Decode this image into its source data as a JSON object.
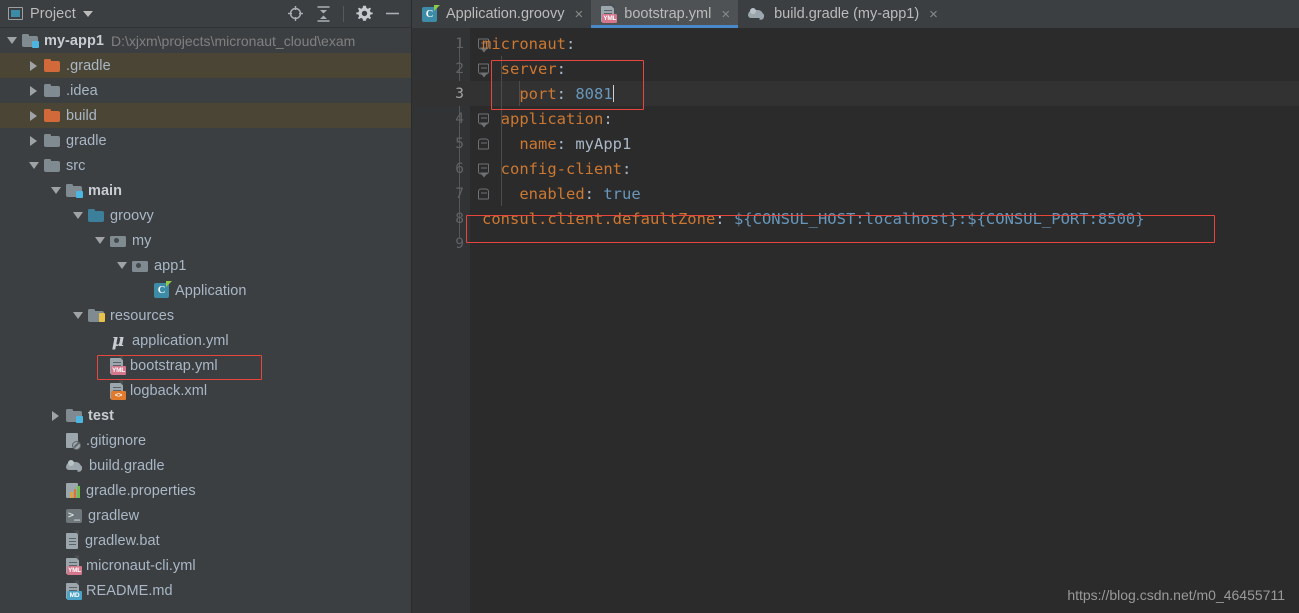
{
  "panel": {
    "title": "Project",
    "window_icon": "window-icon",
    "dropdown_icon": "chevron-down-icon",
    "tools": [
      {
        "name": "locate-icon",
        "label": ""
      },
      {
        "name": "collapse-all-icon",
        "label": ""
      },
      {
        "name": "gear-icon",
        "label": ""
      },
      {
        "name": "minimize-icon",
        "label": ""
      }
    ]
  },
  "tree": {
    "root": {
      "label": "my-app1",
      "path": "D:\\xjxm\\projects\\micronaut_cloud\\exam"
    },
    "items": [
      {
        "label": ".gradle",
        "indent": 1,
        "twisty": "right",
        "icon": "folder-orange",
        "excluded": true
      },
      {
        "label": ".idea",
        "indent": 1,
        "twisty": "right",
        "icon": "folder-grey",
        "excluded": false
      },
      {
        "label": "build",
        "indent": 1,
        "twisty": "right",
        "icon": "folder-orange",
        "excluded": true
      },
      {
        "label": "gradle",
        "indent": 1,
        "twisty": "right",
        "icon": "folder-grey",
        "excluded": false
      },
      {
        "label": "src",
        "indent": 1,
        "twisty": "down",
        "icon": "folder-grey",
        "excluded": false
      },
      {
        "label": "main",
        "indent": 2,
        "twisty": "down",
        "icon": "folder-module",
        "excluded": false,
        "bold": true
      },
      {
        "label": "groovy",
        "indent": 3,
        "twisty": "down",
        "icon": "folder-source",
        "excluded": false
      },
      {
        "label": "my",
        "indent": 4,
        "twisty": "down",
        "icon": "package",
        "excluded": false
      },
      {
        "label": "app1",
        "indent": 5,
        "twisty": "down",
        "icon": "package",
        "excluded": false
      },
      {
        "label": "Application",
        "indent": 6,
        "twisty": "none",
        "icon": "groovy-class",
        "excluded": false
      },
      {
        "label": "resources",
        "indent": 3,
        "twisty": "down",
        "icon": "folder-resources",
        "excluded": false
      },
      {
        "label": "application.yml",
        "indent": 4,
        "twisty": "none",
        "icon": "micronaut-file",
        "excluded": false
      },
      {
        "label": "bootstrap.yml",
        "indent": 4,
        "twisty": "none",
        "icon": "yml-file",
        "excluded": false,
        "highlight": true
      },
      {
        "label": "logback.xml",
        "indent": 4,
        "twisty": "none",
        "icon": "xml-file",
        "excluded": false
      },
      {
        "label": "test",
        "indent": 2,
        "twisty": "right",
        "icon": "folder-module",
        "excluded": false,
        "bold": true
      },
      {
        "label": ".gitignore",
        "indent": 2,
        "twisty": "none",
        "icon": "gitignore-file",
        "excluded": false
      },
      {
        "label": "build.gradle",
        "indent": 2,
        "twisty": "none",
        "icon": "gradle-file",
        "excluded": false
      },
      {
        "label": "gradle.properties",
        "indent": 2,
        "twisty": "none",
        "icon": "properties-file",
        "excluded": false
      },
      {
        "label": "gradlew",
        "indent": 2,
        "twisty": "none",
        "icon": "shell-file",
        "excluded": false
      },
      {
        "label": "gradlew.bat",
        "indent": 2,
        "twisty": "none",
        "icon": "bat-file",
        "excluded": false
      },
      {
        "label": "micronaut-cli.yml",
        "indent": 2,
        "twisty": "none",
        "icon": "yml-file",
        "excluded": false
      },
      {
        "label": "README.md",
        "indent": 2,
        "twisty": "none",
        "icon": "md-file",
        "excluded": false
      }
    ]
  },
  "tabs": [
    {
      "label": "Application.groovy",
      "icon": "groovy-class-icon",
      "active": false,
      "close": "×"
    },
    {
      "label": "bootstrap.yml",
      "icon": "yml-file-icon",
      "active": true,
      "close": "×"
    },
    {
      "label": "build.gradle (my-app1)",
      "icon": "gradle-file-icon",
      "active": false,
      "close": "×"
    }
  ],
  "editor": {
    "line_numbers": [
      "1",
      "2",
      "3",
      "4",
      "5",
      "6",
      "7",
      "8",
      "9"
    ],
    "current_line": 3,
    "lines": [
      {
        "n": 1,
        "indent": 0,
        "key": "micronaut",
        "sep": ":",
        "value": ""
      },
      {
        "n": 2,
        "indent": 1,
        "key": "server",
        "sep": ":",
        "value": ""
      },
      {
        "n": 3,
        "indent": 2,
        "key": "port",
        "sep": ": ",
        "value": "8081",
        "cursor": true
      },
      {
        "n": 4,
        "indent": 1,
        "key": "application",
        "sep": ":",
        "value": ""
      },
      {
        "n": 5,
        "indent": 2,
        "key": "name",
        "sep": ": ",
        "value": "myApp1",
        "value_plain": true
      },
      {
        "n": 6,
        "indent": 1,
        "key": "config-client",
        "sep": ":",
        "value": ""
      },
      {
        "n": 7,
        "indent": 2,
        "key": "enabled",
        "sep": ": ",
        "value": "true"
      },
      {
        "n": 8,
        "indent": 0,
        "key": "consul.client.defaultZone",
        "sep": ": ",
        "value": "${CONSUL_HOST:localhost}:${CONSUL_PORT:8500}",
        "highlight": true
      },
      {
        "n": 9,
        "indent": 0,
        "key": "",
        "sep": "",
        "value": ""
      }
    ]
  },
  "watermark": "https://blog.csdn.net/m0_46455711",
  "colors": {
    "panel_bg": "#3C3F41",
    "editor_bg": "#2B2B2B",
    "gutter_bg": "#313335",
    "key": "#CC7832",
    "value": "#6897BB",
    "text": "#A9B7C6",
    "highlight_box": "#E8453C",
    "active_tab_underline": "#4A88C7",
    "excluded_row": "#4B4535"
  }
}
